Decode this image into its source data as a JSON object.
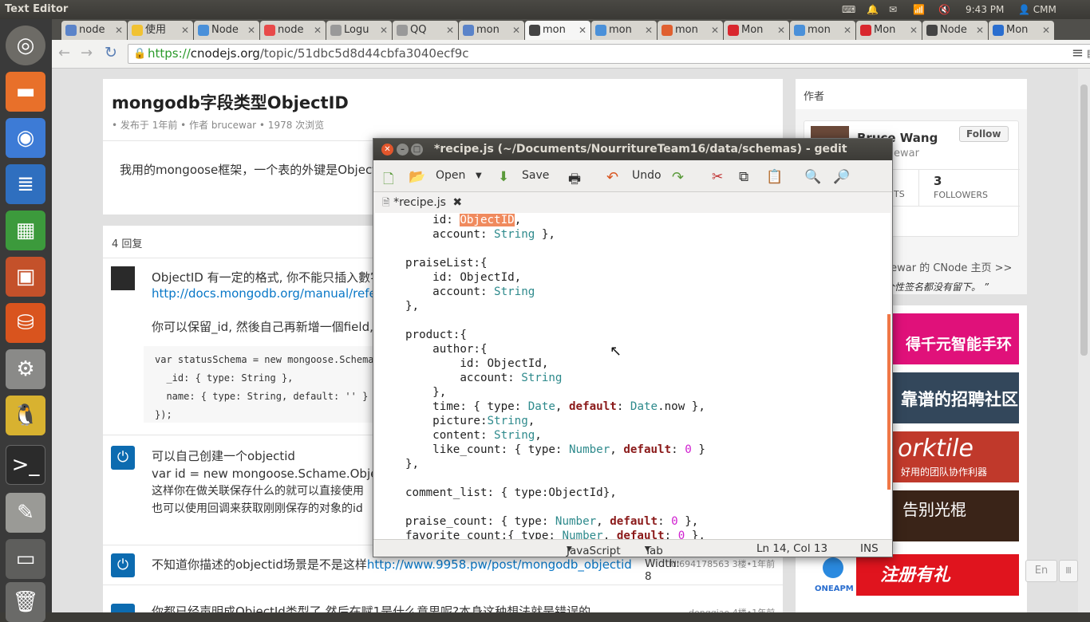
{
  "topbar": {
    "title": "Text Editor",
    "time": "9:43 PM",
    "user": "CMM"
  },
  "tabs": [
    {
      "label": "node",
      "color": "#5a83c9"
    },
    {
      "label": "使用",
      "color": "#f1c232"
    },
    {
      "label": "Node",
      "color": "#4a90d9"
    },
    {
      "label": "node",
      "color": "#e84a4a"
    },
    {
      "label": "Logu",
      "color": "#999999"
    },
    {
      "label": "QQ",
      "color": "#999999"
    },
    {
      "label": "mon",
      "color": "#5a83c9"
    },
    {
      "label": "mon",
      "color": "#444444"
    },
    {
      "label": "mon",
      "color": "#4a90d9"
    },
    {
      "label": "mon",
      "color": "#e06030"
    },
    {
      "label": "Mon",
      "color": "#d9272e"
    },
    {
      "label": "mon",
      "color": "#4a90d9"
    },
    {
      "label": "Mon",
      "color": "#d9272e"
    },
    {
      "label": "Node",
      "color": "#444444"
    },
    {
      "label": "Mon",
      "color": "#2a6ecf"
    }
  ],
  "url": {
    "scheme": "https://",
    "host": "cnodejs.org",
    "path": "/topic/51dbc5d8d44cbfa3040ecf9c"
  },
  "topic": {
    "title": "mongodb字段类型ObjectID",
    "meta": "• 发布于 1年前 • 作者 brucewar • 1978 次浏览",
    "body": "我用的mongoose框架，一个表的外键是Object"
  },
  "replies": {
    "count_label": "4 回复",
    "r1_line1": "ObjectID 有一定的格式, 你不能只插入數字",
    "r1_link": "http://docs.mongodb.org/manual/refe",
    "r1_line2": "你可以保留_id, 然後自己再新增一個field,",
    "r1_code": [
      "var statusSchema = new mongoose.Schema",
      "  _id: { type: String },",
      "  name: { type: String, default: '' }",
      "});"
    ],
    "r2": [
      "可以自己创建一个objectid",
      "var id = new mongoose.Schame.Obje",
      "这样你在做关联保存什么的就可以直接使用",
      "也可以使用回调来获取刚刚保存的对象的id"
    ],
    "r3_text": "不知道你描述的objectid场景是不是这样",
    "r3_link": "http://www.9958.pw/post/mongodb_objectid",
    "r3_meta": "ldl694178563 3楼•1年前",
    "r4_text": "你都已经声明成ObjectId类型了 然后在赋1是什么意思呢?本身这种想法就是错误的",
    "r4_meta": "dengqiao 4楼•1年前"
  },
  "sidebar": {
    "heading": "作者",
    "name": "Bruce Wang",
    "handle": "ewar",
    "follow": "Follow",
    "stat_label1": "TS",
    "followers_count": "3",
    "followers_label": "FOLLOWERS",
    "home_link": "cewar 的 CNode 主页 >>",
    "signature": "个性签名都没有留下。 ”",
    "ad1": "得千元智能手环",
    "ad2": "靠谱的招聘社区",
    "ad3": "orktile",
    "ad3_sub": "好用的团队协作利器",
    "ad4": "告别光棍",
    "ad5": "注册有礼",
    "ad5_sub": "ONEAPM",
    "lang_btn": "En"
  },
  "gedit": {
    "title": "*recipe.js (~/Documents/NourritureTeam16/data/schemas) - gedit",
    "open": "Open",
    "save": "Save",
    "undo": "Undo",
    "tab": "*recipe.js",
    "status_lang": "JavaScript",
    "status_tab": "Tab Width: 8",
    "status_pos": "Ln 14, Col 13",
    "status_ins": "INS"
  }
}
